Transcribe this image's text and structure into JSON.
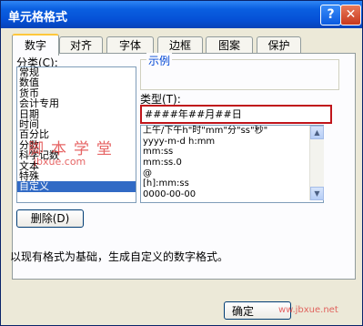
{
  "window": {
    "title": "单元格格式",
    "help_glyph": "?",
    "close_glyph": "✕"
  },
  "tabs": [
    "数字",
    "对齐",
    "字体",
    "边框",
    "图案",
    "保护"
  ],
  "category": {
    "label": "分类(C):",
    "items": [
      "常规",
      "数值",
      "货币",
      "会计专用",
      "日期",
      "时间",
      "百分比",
      "分数",
      "科学记数",
      "文本",
      "特殊",
      "自定义"
    ],
    "selected": "自定义"
  },
  "sample": {
    "title": "示例",
    "value": ""
  },
  "type": {
    "label": "类型(T):",
    "value": "####年##月##日",
    "options": [
      "上午/下午h\"时\"mm\"分\"ss\"秒\"",
      "yyyy-m-d h:mm",
      "mm:ss",
      "mm:ss.0",
      "@",
      "[h]:mm:ss",
      "0000-00-00"
    ]
  },
  "delete_button": "删除(D)",
  "description": "以现有格式为基础，生成自定义的数字格式。",
  "ok_button": "确定",
  "watermark": {
    "cn": "脚本学堂",
    "url": "jbxue.com",
    "footer": "ww.jbxue.net"
  },
  "colors": {
    "titlebar": "#0550d6",
    "selection": "#316ac5",
    "highlight_border": "#c0151b",
    "watermark": "#dc2828"
  }
}
